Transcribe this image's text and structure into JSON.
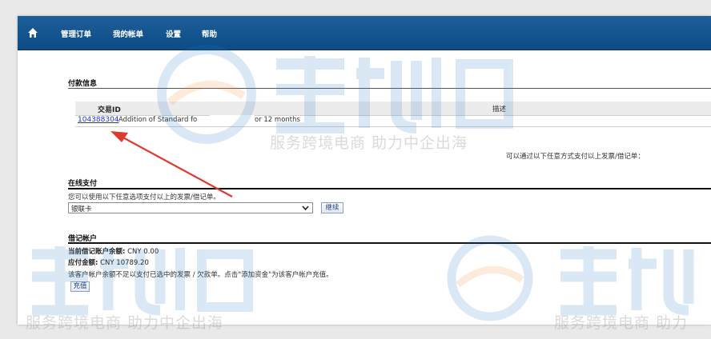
{
  "nav": {
    "home_icon": "home-icon",
    "items": [
      "管理订单",
      "我的帐单",
      "设置",
      "帮助"
    ]
  },
  "payment_info": {
    "title": "付款信息",
    "columns": {
      "transaction_id": "交易ID",
      "description": "描述"
    },
    "rows": [
      {
        "transaction_id": "104388304",
        "description_visible_start": "Addition of Standard fo",
        "description_visible_end": "or 12 months"
      }
    ],
    "note": "可以通过以下任意方式支付以上发票/借记单："
  },
  "online_payment": {
    "title": "在线支付",
    "note": "您可以使用以下任意选项支付以上的发票/借记单。",
    "method_selected": "银联卡",
    "continue_label": "继续"
  },
  "credit_account": {
    "title": "借记帐户",
    "balance_label": "当前借记账户余额:",
    "balance_value": "CNY 0.00",
    "amount_due_label": "应付金额:",
    "amount_due_value": "CNY 10789.20",
    "note": "该客户帐户余额不足以支付已选中的发票 / 欠款单。点击\"添加资金\"为该客户帐户充值。",
    "topup_label": "充值"
  },
  "watermark": {
    "brand": "主机侦探",
    "caption": "服务跨境电商 助力中企出海",
    "caption_short": "服务跨境电商 助力"
  },
  "colors": {
    "nav_bg": "#0d4c86",
    "link": "#2233cc",
    "annotation_arrow": "#e03a2f",
    "watermark_blue": "#1e78c8",
    "watermark_orange": "#f08a24"
  }
}
